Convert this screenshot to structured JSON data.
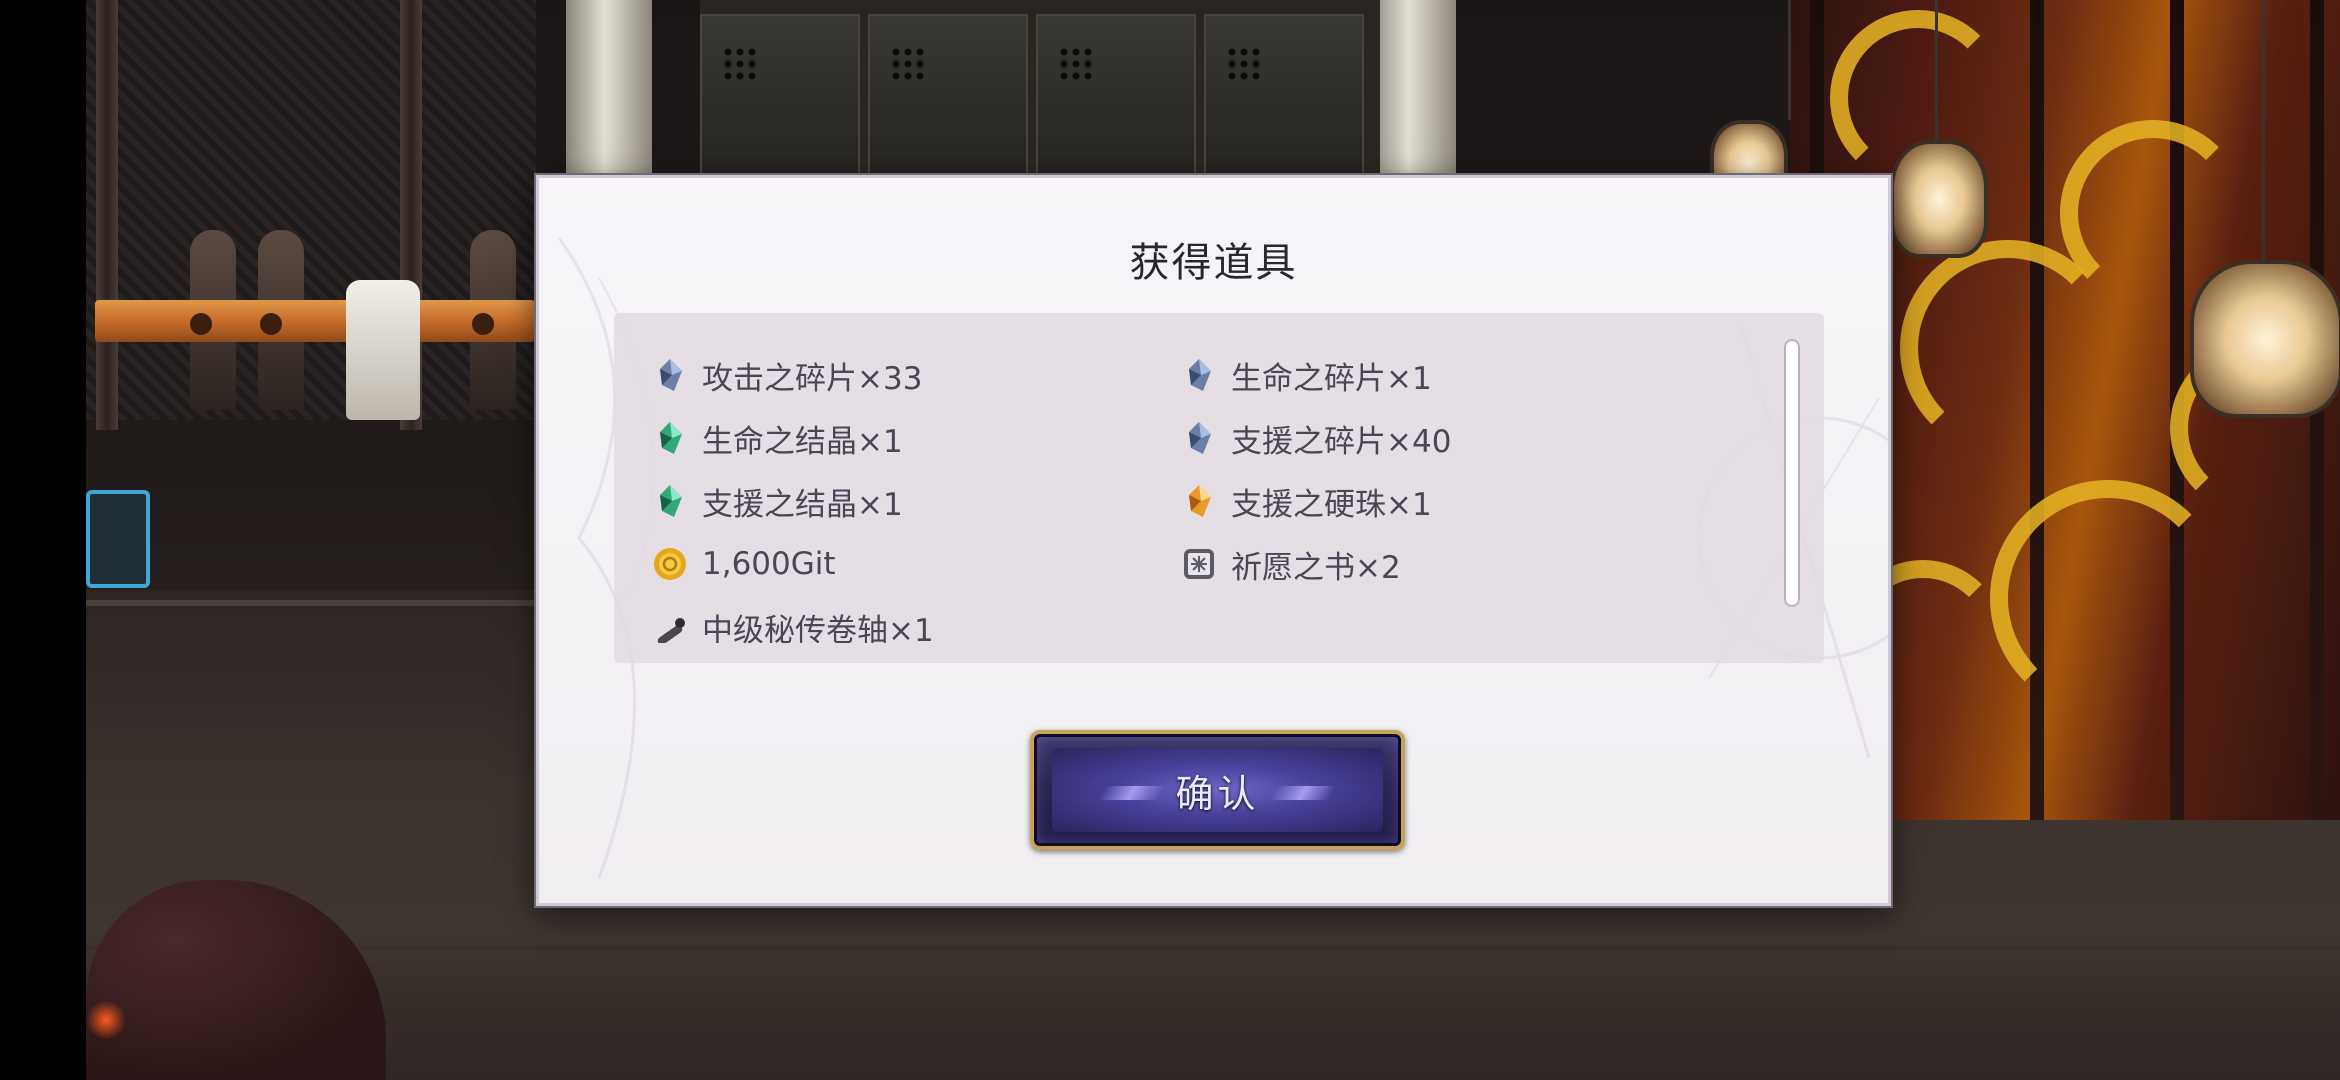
{
  "dialog": {
    "title": "获得道具",
    "confirm_label": "确认"
  },
  "items": [
    {
      "label": "攻击之碎片×33",
      "icon": "attack-shard-icon"
    },
    {
      "label": "生命之碎片×1",
      "icon": "life-shard-icon"
    },
    {
      "label": "生命之结晶×1",
      "icon": "life-crystal-icon"
    },
    {
      "label": "支援之碎片×40",
      "icon": "support-shard-icon"
    },
    {
      "label": "支援之结晶×1",
      "icon": "support-crystal-icon"
    },
    {
      "label": "支援之硬珠×1",
      "icon": "support-hard-orb-icon"
    },
    {
      "label": "1,600Git",
      "icon": "gold-coin-icon"
    },
    {
      "label": "祈愿之书×2",
      "icon": "prayer-book-icon"
    },
    {
      "label": "中级秘传卷轴×1",
      "icon": "scroll-icon"
    }
  ],
  "colors": {
    "dialog_bg": "#f4f1f5",
    "panel_bg": "#e2dae2",
    "text": "#4b4656",
    "button_gold": "#c7a35a",
    "button_purple": "#463f97"
  }
}
